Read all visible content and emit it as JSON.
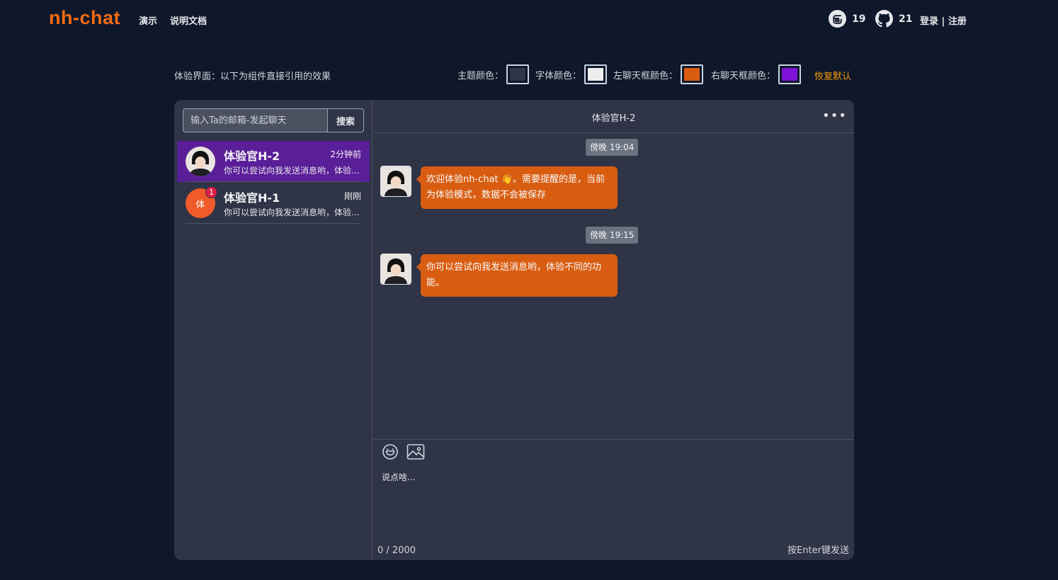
{
  "header": {
    "logo": "nh-chat",
    "nav": [
      "演示",
      "说明文档"
    ],
    "gitee_count": "19",
    "github_count": "21",
    "login": "登录",
    "separator": " | ",
    "register": "注册"
  },
  "config": {
    "note": "体验界面：以下为组件直接引用的效果",
    "theme_label": "主题颜色：",
    "font_label": "字体颜色：",
    "left_bubble_label": "左聊天框颜色：",
    "right_bubble_label": "右聊天框颜色：",
    "reset": "恢复默认",
    "colors": {
      "theme": "#2f3446",
      "font": "#eeeeee",
      "left_bubble": "#d95d10",
      "right_bubble": "#7e12d6"
    }
  },
  "sidebar": {
    "search_placeholder": "输入Ta的邮箱-发起聊天",
    "search_button": "搜索",
    "conversations": [
      {
        "name": "体验官H-2",
        "time": "2分钟前",
        "preview": "你可以尝试向我发送消息哟，体验不同的功能。",
        "active": true
      },
      {
        "name": "体验官H-1",
        "time": "刚刚",
        "preview": "你可以尝试向我发送消息哟，体验不同的功能。",
        "avatar_text": "体",
        "badge": "1"
      }
    ]
  },
  "chat": {
    "title": "体验官H-2",
    "more": "•••",
    "messages": [
      {
        "time": "傍晚 19:04",
        "text": "欢迎体验nh-chat 👋。需要提醒的是，当前为体验模式，数据不会被保存"
      },
      {
        "time": "傍晚 19:15",
        "text": "你可以尝试向我发送消息哟，体验不同的功能。"
      }
    ],
    "composer_placeholder": "说点啥...",
    "counter": "0 / 2000",
    "hint": "按Enter键发送"
  }
}
